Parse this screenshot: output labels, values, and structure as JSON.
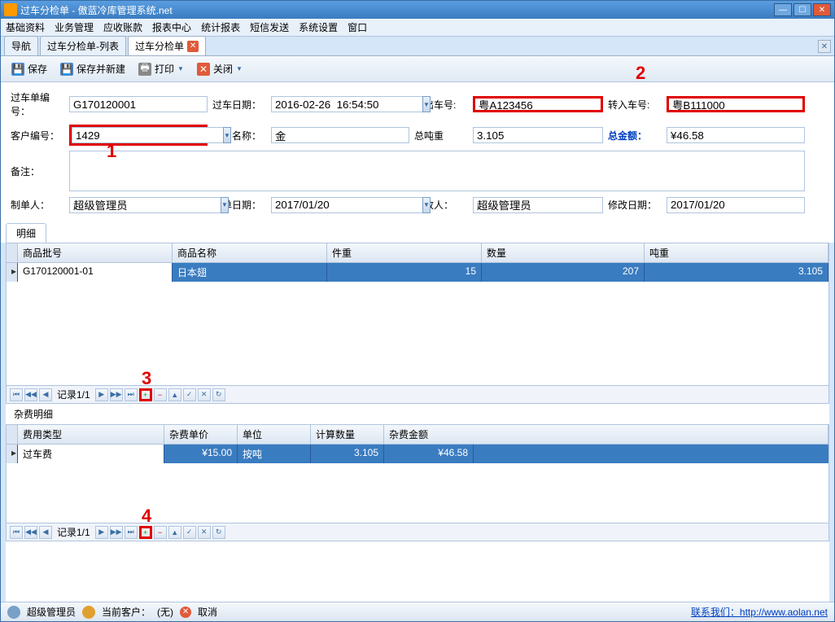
{
  "window": {
    "title": "过车分检单 - 傲蓝冷库管理系统.net"
  },
  "menu": [
    "基础资料",
    "业务管理",
    "应收账款",
    "报表中心",
    "统计报表",
    "短信发送",
    "系统设置",
    "窗口"
  ],
  "tabs": [
    {
      "label": "导航",
      "closable": false
    },
    {
      "label": "过车分检单-列表",
      "closable": false
    },
    {
      "label": "过车分检单",
      "closable": true,
      "active": true
    }
  ],
  "toolbar": {
    "save": "保存",
    "save_new": "保存并新建",
    "print": "打印",
    "close": "关闭"
  },
  "form": {
    "bill_no_label": "过车单编号：",
    "bill_no": "G170120001",
    "date_label": "过车日期：",
    "date": "2016-02-26  16:54:50",
    "out_car_label": "转出车号:",
    "out_car": "粤A123456",
    "in_car_label": "转入车号:",
    "in_car": "粤B111000",
    "cust_no_label": "客户编号：",
    "cust_no": "1429",
    "cust_name_label": "客户名称：",
    "cust_name": "金",
    "total_weight_label": "总吨重",
    "total_weight": "3.105",
    "total_amount_label": "总金额：",
    "total_amount": "¥46.58",
    "remark_label": "备注：",
    "remark": "",
    "maker_label": "制单人：",
    "maker": "超级管理员",
    "make_date_label": "制单日期：",
    "make_date": "2017/01/20",
    "modifier_label": "修改人：",
    "modifier": "超级管理员",
    "modify_date_label": "修改日期：",
    "modify_date": "2017/01/20"
  },
  "annotations": {
    "a1": "1",
    "a2": "2",
    "a3": "3",
    "a4": "4"
  },
  "detail_tab": "明细",
  "detail_cols": [
    "商品批号",
    "商品名称",
    "件重",
    "数量",
    "吨重"
  ],
  "detail_rows": [
    {
      "batch": "G170120001-01",
      "name": "日本翅",
      "pw": "15",
      "qty": "207",
      "tw": "3.105"
    }
  ],
  "fee_header": "杂费明细",
  "fee_cols": [
    "费用类型",
    "杂费单价",
    "单位",
    "计算数量",
    "杂费金额"
  ],
  "fee_rows": [
    {
      "type": "过车费",
      "price": "¥15.00",
      "unit": "按吨",
      "qty": "3.105",
      "amount": "¥46.58"
    }
  ],
  "nav": {
    "record": "记录1/1"
  },
  "status": {
    "user": "超级管理员",
    "current_cust_label": "当前客户：",
    "current_cust": "(无)",
    "cancel": "取消",
    "contact_label": "联系我们：",
    "contact_url": "http://www.aolan.net"
  }
}
